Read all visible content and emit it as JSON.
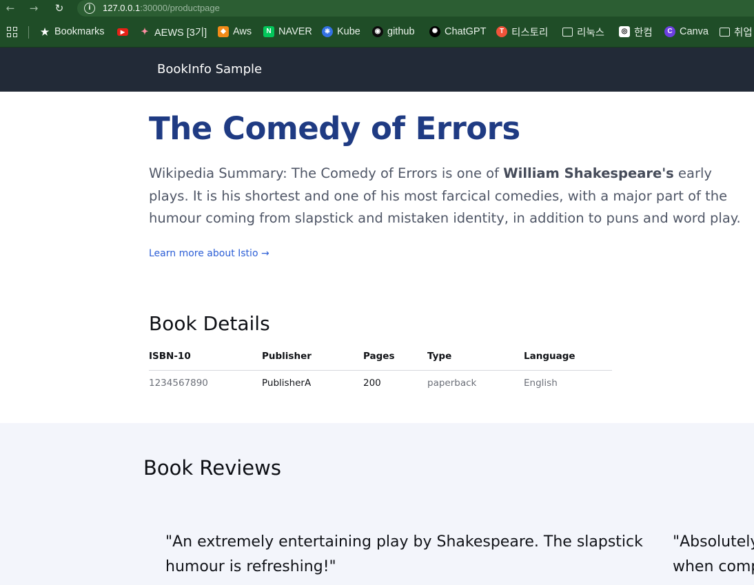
{
  "browser": {
    "url_host": "127.0.0.1",
    "url_path": ":30000/productpage"
  },
  "bookmarks": [
    {
      "label": "Bookmarks",
      "icon": "star-icon"
    },
    {
      "label": "",
      "icon": "youtube-icon"
    },
    {
      "label": "AEWS [3기]",
      "icon": "rocket-icon"
    },
    {
      "label": "Aws",
      "icon": "aws-cube-icon"
    },
    {
      "label": "NAVER",
      "icon": "naver-icon"
    },
    {
      "label": "Kube",
      "icon": "kubernetes-icon"
    },
    {
      "label": "github",
      "icon": "github-icon"
    },
    {
      "label": "ChatGPT",
      "icon": "chatgpt-icon"
    },
    {
      "label": "티스토리",
      "icon": "tistory-icon"
    },
    {
      "label": "리눅스",
      "icon": "folder-icon"
    },
    {
      "label": "한컴",
      "icon": "hancom-icon"
    },
    {
      "label": "Canva",
      "icon": "canva-icon"
    },
    {
      "label": "취업",
      "icon": "folder-icon"
    }
  ],
  "header": {
    "brand": "BookInfo Sample"
  },
  "product": {
    "title": "The Comedy of Errors",
    "summary_before": "Wikipedia Summary: The Comedy of Errors is one of ",
    "summary_bold": "William Shakespeare's",
    "summary_after": " early plays. It is his shortest and one of his most farcical comedies, with a major part of the humour coming from slapstick and mistaken identity, in addition to puns and word play.",
    "learn_more": "Learn more about Istio →"
  },
  "details": {
    "heading": "Book Details",
    "columns": [
      "ISBN-10",
      "Publisher",
      "Pages",
      "Type",
      "Language"
    ],
    "row": [
      "1234567890",
      "PublisherA",
      "200",
      "paperback",
      "English"
    ]
  },
  "reviews": {
    "heading": "Book Reviews",
    "items": [
      {
        "text": "\"An extremely entertaining play by Shakespeare. The slapstick\nhumour is refreshing!\""
      },
      {
        "text": "\"Absolutely\nwhen comp"
      }
    ]
  },
  "colors": {
    "chrome": "#1f4d27",
    "header_bg": "#222a37",
    "title": "#1f3b83",
    "link": "#2d5fd6",
    "reviews_bg": "#f3f5fb"
  }
}
